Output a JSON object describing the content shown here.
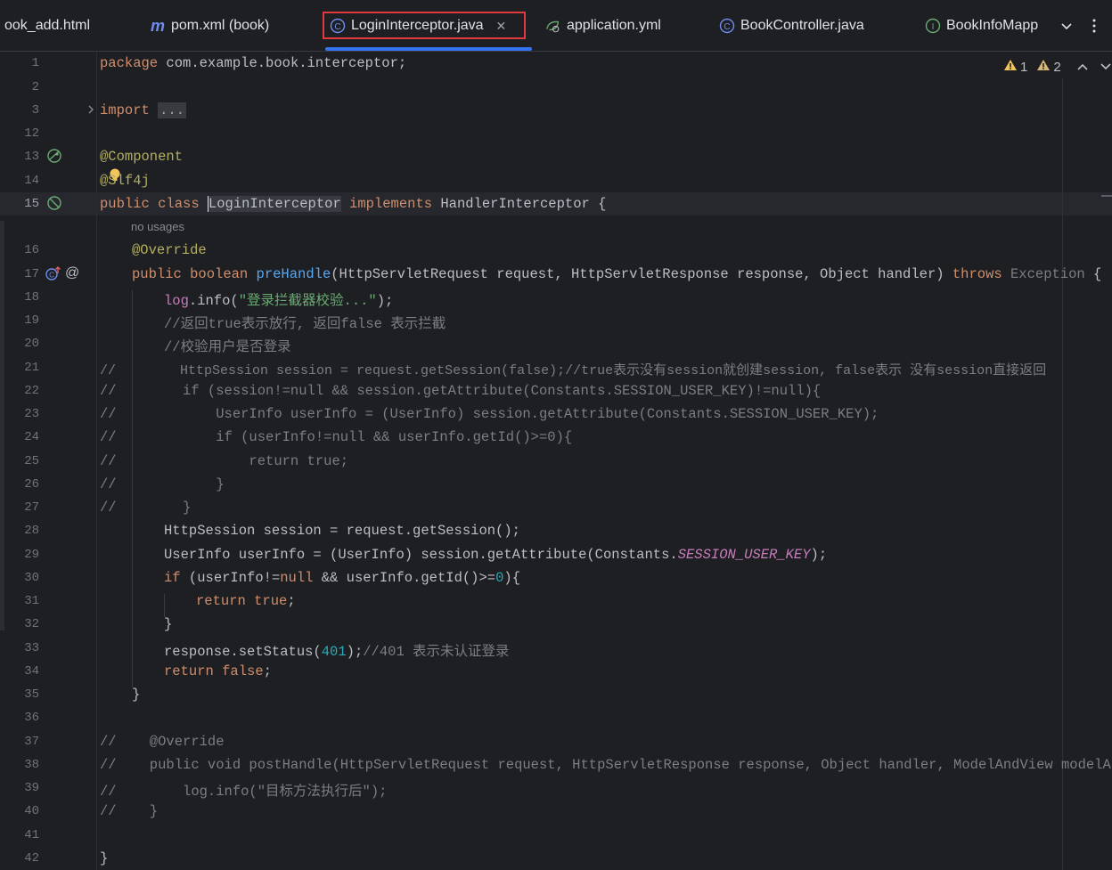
{
  "tabs": [
    {
      "label": "book_add.html",
      "icon": "html-file-icon"
    },
    {
      "label": "pom.xml (book)",
      "icon": "maven-icon"
    },
    {
      "label": "LoginInterceptor.java",
      "icon": "class-icon",
      "active": true
    },
    {
      "label": "application.yml",
      "icon": "spring-config-icon"
    },
    {
      "label": "BookController.java",
      "icon": "class-icon"
    },
    {
      "label": "BookInfoMapp",
      "icon": "interface-icon"
    }
  ],
  "tab_shown_text": "ook_add.html",
  "inspections": {
    "warnings": "1",
    "weak_warnings": "2"
  },
  "hint_no_usages": "no usages",
  "colors": {
    "active_border": "#e0393d",
    "active_underline": "#3574f0"
  },
  "lines": [
    {
      "n": "1"
    },
    {
      "n": "2"
    },
    {
      "n": "3"
    },
    {
      "n": "12"
    },
    {
      "n": "13"
    },
    {
      "n": "14"
    },
    {
      "n": "15"
    },
    {
      "n": "16"
    },
    {
      "n": "17"
    },
    {
      "n": "18"
    },
    {
      "n": "19"
    },
    {
      "n": "20"
    },
    {
      "n": "21"
    },
    {
      "n": "22"
    },
    {
      "n": "23"
    },
    {
      "n": "24"
    },
    {
      "n": "25"
    },
    {
      "n": "26"
    },
    {
      "n": "27"
    },
    {
      "n": "28"
    },
    {
      "n": "29"
    },
    {
      "n": "30"
    },
    {
      "n": "31"
    },
    {
      "n": "32"
    },
    {
      "n": "33"
    },
    {
      "n": "34"
    },
    {
      "n": "35"
    },
    {
      "n": "36"
    },
    {
      "n": "37"
    },
    {
      "n": "38"
    },
    {
      "n": "39"
    },
    {
      "n": "40"
    },
    {
      "n": "41"
    },
    {
      "n": "42"
    }
  ],
  "code": {
    "l1_kw": "package",
    "l1_rest": " com.example.book.interceptor;",
    "l3_kw": "import",
    "l3_fold": "...",
    "l13": "@Component",
    "l14_a": "@S",
    "l14_b": "lf4j",
    "l15_a": "public class ",
    "l15_name": "LoginInterceptor",
    "l15_b": " implements ",
    "l15_c": "HandlerInterceptor {",
    "l16": "@Override",
    "l17_a": "public boolean ",
    "l17_fn": "preHandle",
    "l17_b": "(HttpServletRequest request, HttpServletResponse response, Object handler) ",
    "l17_kw": "throws",
    "l17_exc": " Exception",
    "l17_c": " {",
    "l18_a": "log",
    "l18_b": ".info(",
    "l18_str": "\"登录拦截器校验...\"",
    "l18_c": ");",
    "l19": "//返回true表示放行, 返回false 表示拦截",
    "l20": "//校验用户是否登录",
    "l21": "//        HttpSession session = request.getSession(false);//true表示没有session就创建session, false表示 没有session直接返回",
    "l22": "//        if (session!=null && session.getAttribute(Constants.SESSION_USER_KEY)!=null){",
    "l23": "//            UserInfo userInfo = (UserInfo) session.getAttribute(Constants.SESSION_USER_KEY);",
    "l24": "//            if (userInfo!=null && userInfo.getId()>=0){",
    "l25": "//                return true;",
    "l26": "//            }",
    "l27": "//        }",
    "l28": "HttpSession session = request.getSession();",
    "l29_a": "UserInfo userInfo = (UserInfo) session.getAttribute(Constants.",
    "l29_const": "SESSION_USER_KEY",
    "l29_b": ");",
    "l30_kw": "if",
    "l30_a": " (userInfo!=",
    "l30_null": "null",
    "l30_b": " && userInfo.getId()>=",
    "l30_num": "0",
    "l30_c": "){",
    "l31_kw": "return true",
    "l31_b": ";",
    "l32": "}",
    "l33_a": "response.setStatus(",
    "l33_num": "401",
    "l33_b": ");",
    "l33_cmt": "//401 表示未认证登录",
    "l34_kw": "return false",
    "l34_b": ";",
    "l35": "}",
    "l37": "//    @Override",
    "l38": "//    public void postHandle(HttpServletRequest request, HttpServletResponse response, Object handler, ModelAndView modelAndView)",
    "l39": "//        log.info(\"目标方法执行后\");",
    "l40": "//    }",
    "l42": "}"
  }
}
